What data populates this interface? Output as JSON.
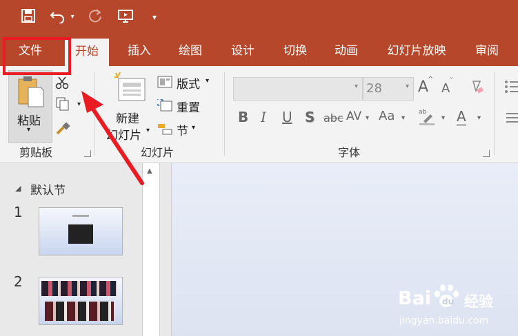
{
  "colors": {
    "accent": "#b7472a",
    "highlight": "#ea1b23"
  },
  "quick_access": {
    "save_icon": "save-icon",
    "undo_icon": "undo-icon",
    "redo_icon": "redo-icon",
    "present_icon": "start-from-beginning-icon",
    "customize_icon": "customize-qat-icon"
  },
  "tabs": [
    {
      "label": "文件"
    },
    {
      "label": "开始"
    },
    {
      "label": "插入"
    },
    {
      "label": "绘图"
    },
    {
      "label": "设计"
    },
    {
      "label": "切换"
    },
    {
      "label": "动画"
    },
    {
      "label": "幻灯片放映"
    },
    {
      "label": "审阅"
    }
  ],
  "ribbon": {
    "clipboard": {
      "paste": "粘贴",
      "group": "剪贴板"
    },
    "slides": {
      "new_slide_1": "新建",
      "new_slide_2": "幻灯片",
      "layout": "版式",
      "reset": "重置",
      "section": "节",
      "group": "幻灯片"
    },
    "font": {
      "size": "28",
      "group": "字体",
      "bold": "B",
      "italic": "I",
      "underline": "U",
      "shadow": "S",
      "strike": "abc",
      "spacing": "AV",
      "case": "Aa",
      "color": "A",
      "grow": "A",
      "shrink": "A"
    }
  },
  "slide_pane": {
    "section": "默认节",
    "slides": [
      {
        "number": "1"
      },
      {
        "number": "2"
      }
    ]
  },
  "watermark": {
    "brand": "Bai",
    "brand2": "经验",
    "url": "jingyan.baidu.com"
  }
}
